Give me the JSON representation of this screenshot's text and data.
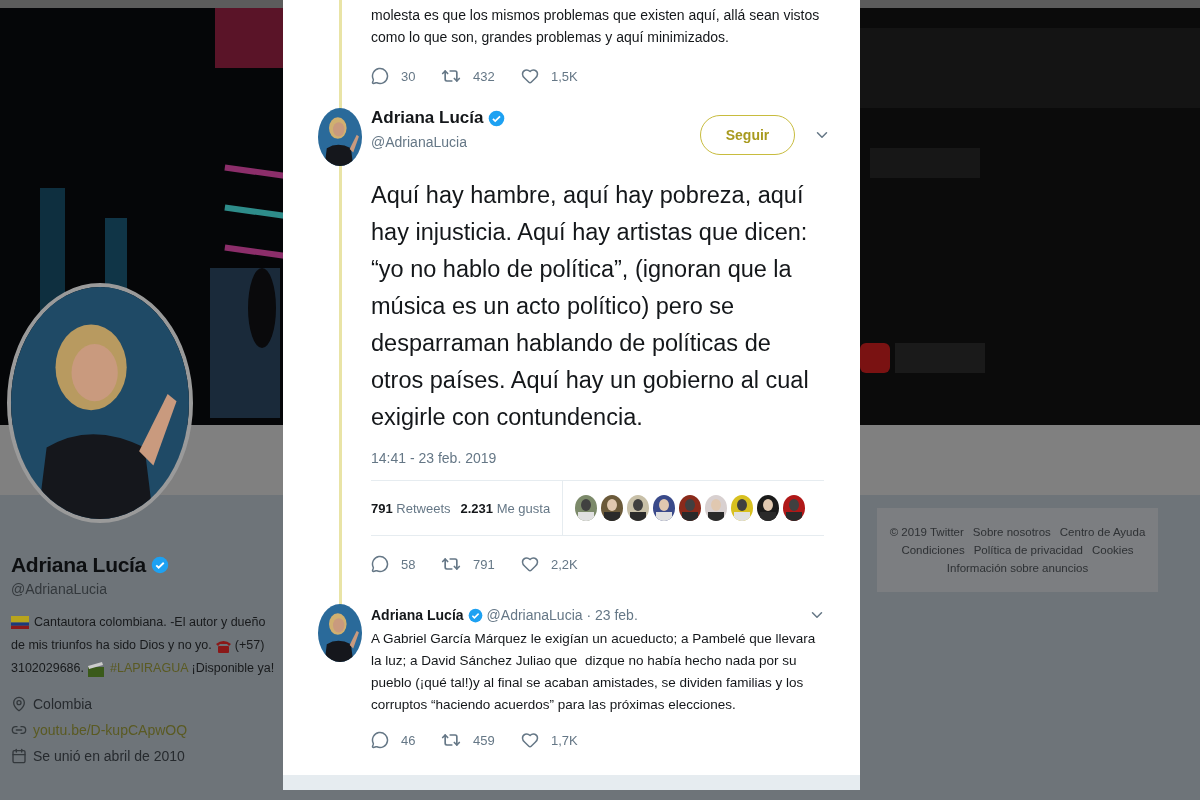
{
  "profile": {
    "name": "Adriana Lucía",
    "verified": true,
    "handle": "@AdrianaLucia",
    "bio": [
      [
        {
          "kind": "flag"
        },
        {
          "kind": "text",
          "text": "Cantautora colombiana. -El autor y dueño"
        }
      ],
      [
        {
          "kind": "text",
          "text": "de mis triunfos ha sido Dios y no yo."
        },
        {
          "kind": "phone"
        },
        {
          "kind": "text",
          "text": "(+57)"
        }
      ],
      [
        {
          "kind": "text",
          "text": "3102029686."
        },
        {
          "kind": "clapper"
        },
        {
          "kind": "hashtag",
          "text": "#LAPIRAGUA"
        },
        {
          "kind": "text",
          "text": "¡Disponible ya!"
        }
      ]
    ],
    "location": "Colombia",
    "link": "youtu.be/D-kupCApwOQ",
    "joined": "Se unió en abril de 2010"
  },
  "footer": {
    "links": [
      "© 2019 Twitter",
      "Sobre nosotros",
      "Centro de Ayuda",
      "Condiciones",
      "Política de privacidad",
      "Cookies",
      "Información sobre anuncios"
    ]
  },
  "modal": {
    "previous_tweet": {
      "text": "molesta es que los mismos problemas que existen aquí, allá sean vistos como lo que son, grandes problemas y aquí minimizados.",
      "actions": {
        "replies": "30",
        "retweets": "432",
        "likes": "1,5K"
      }
    },
    "tweet": {
      "author": {
        "name": "Adriana Lucía",
        "verified": true,
        "handle": "@AdrianaLucia"
      },
      "follow_button": "Seguir",
      "text": "Aquí hay hambre, aquí hay pobreza, aquí hay injusticia. Aquí hay artistas que dicen: “yo no hablo de política”, (ignoran que la música es un acto político) pero se desparraman hablando de políticas de otros países. Aquí hay un gobierno al cual exigirle con contundencia.",
      "timestamp": "14:41 - 23 feb. 2019",
      "stats": {
        "retweets_count": "791",
        "retweets_label": "Retweets",
        "likes_count": "2.231",
        "likes_label": "Me gusta"
      },
      "actions": {
        "replies": "58",
        "retweets": "791",
        "likes": "2,2K"
      }
    },
    "reply": {
      "author": {
        "name": "Adriana Lucía",
        "verified": true,
        "meta": "@AdrianaLucia · 23 feb."
      },
      "text": "A Gabriel García Márquez le exigían un acueducto; a Pambelé que llevara la luz; a David Sánchez Juliao que  dizque no había hecho nada por su pueblo (¡qué tal!)y al final se acaban amistades, se dividen familias y los corruptos “haciendo acuerdos” para las próximas elecciones.",
      "actions": {
        "replies": "46",
        "retweets": "459",
        "likes": "1,7K"
      }
    }
  }
}
